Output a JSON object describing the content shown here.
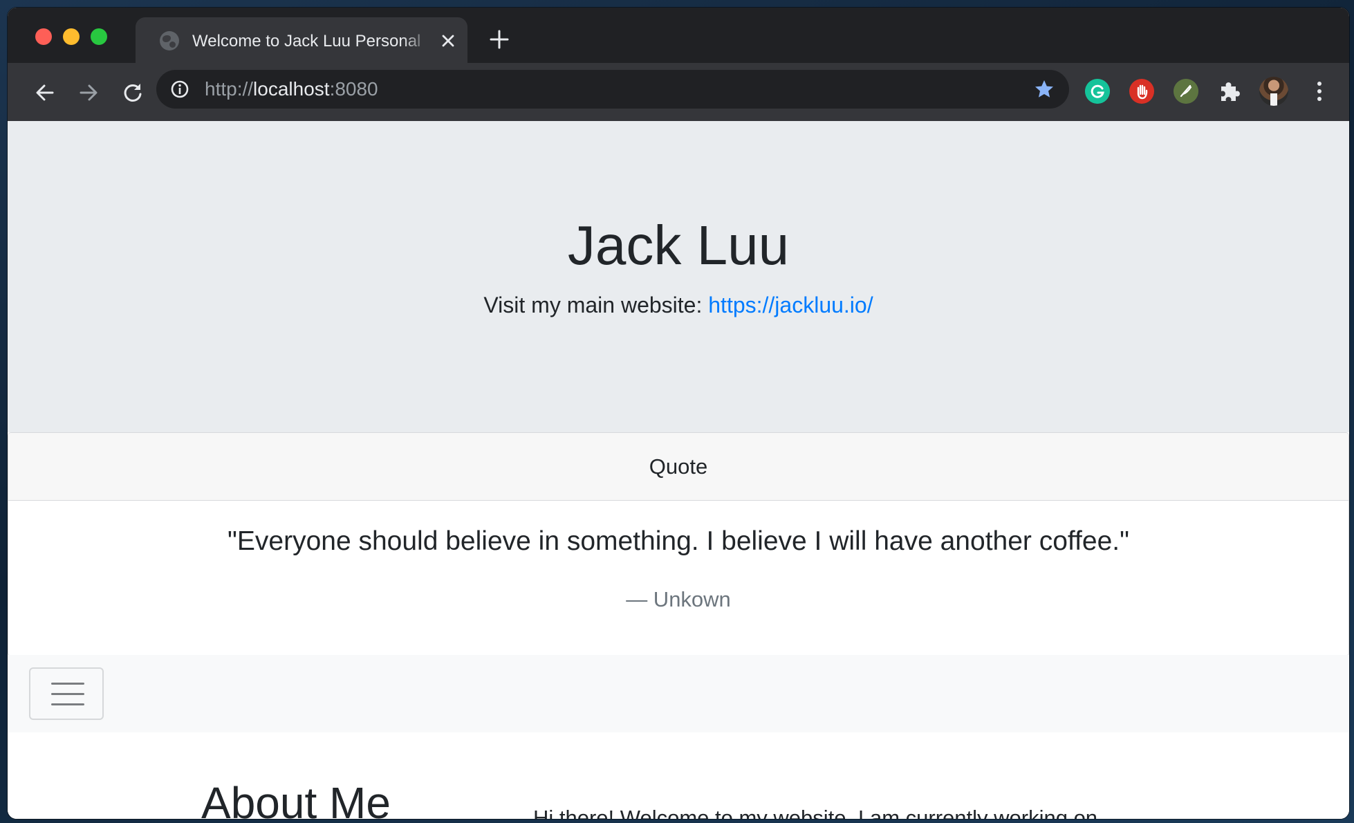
{
  "browser": {
    "tab": {
      "title": "Welcome to Jack Luu Personal",
      "favicon": "globe-icon"
    },
    "address_bar": {
      "scheme": "http://",
      "host": "localhost",
      "port": ":8080"
    },
    "extensions": [
      "grammarly-icon",
      "adblock-icon",
      "feather-icon",
      "puzzle-icon"
    ],
    "colors": {
      "tabstrip": "#202124",
      "toolbar": "#35363a",
      "star": "#8ab4f8"
    }
  },
  "hero": {
    "title": "Jack Luu",
    "subtitle_prefix": "Visit my main website: ",
    "link_text": "https://jackluu.io/"
  },
  "quote_card": {
    "header": "Quote",
    "quote": "\"Everyone should believe in something. I believe I will have another coffee.\"",
    "author": "— Unkown"
  },
  "navbar": {
    "toggler_icon": "hamburger-icon"
  },
  "about": {
    "heading": "About Me",
    "intro": "Hi there! Welcome to my website. I am currently working on"
  },
  "colors": {
    "jumbotron_bg": "#e9ecef",
    "link": "#007bff",
    "muted": "#6c757d",
    "text": "#212529"
  }
}
